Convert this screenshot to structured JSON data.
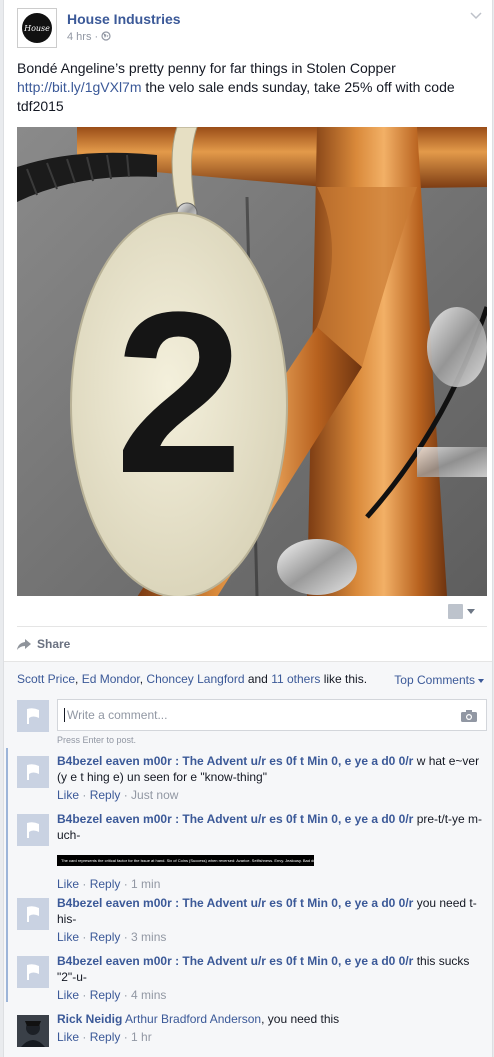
{
  "post": {
    "page_name": "House Industries",
    "time": "4 hrs",
    "separator": "·",
    "avatar_label": "House",
    "text_line1": "Bondé Angeline’s pretty penny for far things in Stolen Copper",
    "link": "http://bit.ly/1gVXl7m",
    "text_rest": " the velo sale ends sunday, take 25% off with code tdf2015",
    "photo_alt": "2",
    "share_label": "Share"
  },
  "likes": {
    "name1": "Scott Price",
    "sep1": ", ",
    "name2": "Ed Mondor",
    "sep2": ", ",
    "name3": "Choncey Langford",
    "and": " and ",
    "others": "11 others",
    "tail": " like this.",
    "top_comments": "Top Comments"
  },
  "composer": {
    "placeholder": "Write a comment...",
    "hint": "Press Enter to post."
  },
  "comments": [
    {
      "author": "B4bezel eaven m00r : The Advent u/r es 0f t Min 0, e ye a d0 0/r",
      "text": " w hat e~ver (y e t hing e) un seen for e \"know-thing\"",
      "like": "Like",
      "reply": "Reply",
      "dot": " · ",
      "time": "Just now"
    },
    {
      "author": "B4bezel eaven m00r : The Advent u/r es 0f t Min 0, e ye a d0 0/r",
      "text": " pre-t/t-ye m-uch-",
      "banner": "The card represents the critical factor for the issue at hand. Six of Coins (Success) when reversed: Avarice. Selfishness. Envy. Jealousy. Bad debt.",
      "like": "Like",
      "reply": "Reply",
      "dot": " · ",
      "time": "1 min"
    },
    {
      "author": "B4bezel eaven m00r : The Advent u/r es 0f t Min 0, e ye a d0 0/r",
      "text": " you need t-his-",
      "like": "Like",
      "reply": "Reply",
      "dot": " · ",
      "time": "3 mins"
    },
    {
      "author": "B4bezel eaven m00r : The Advent u/r es 0f t Min 0, e ye a d0 0/r",
      "text": " this sucks \"2\"-u-",
      "like": "Like",
      "reply": "Reply",
      "dot": " · ",
      "time": "4 mins"
    },
    {
      "author": "Rick Neidig",
      "mention": " Arthur Bradford Anderson",
      "text": ", you need this",
      "like": "Like",
      "reply": "Reply",
      "dot": " · ",
      "time": "1 hr"
    }
  ],
  "colors": {
    "link": "#3b5998",
    "muted": "#9197a3",
    "copper": "#c0702a"
  }
}
